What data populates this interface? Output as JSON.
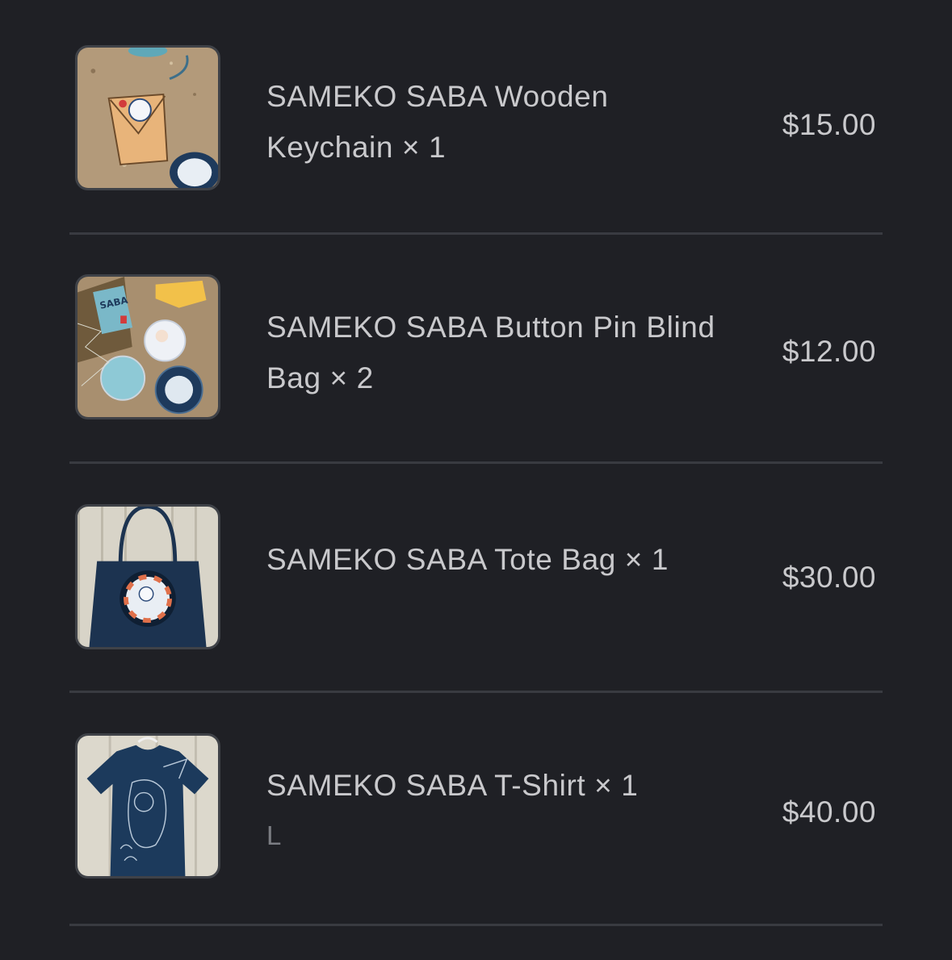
{
  "items": [
    {
      "name": "SAMEKO SABA Wooden Keychain × 1",
      "variant": "",
      "price": "$15.00",
      "image": "wooden-keychain-photo"
    },
    {
      "name": "SAMEKO SABA Button Pin Blind Bag × 2",
      "variant": "",
      "price": "$12.00",
      "image": "button-pin-photo"
    },
    {
      "name": "SAMEKO SABA Tote Bag × 1",
      "variant": "",
      "price": "$30.00",
      "image": "tote-bag-photo"
    },
    {
      "name": "SAMEKO SABA T-Shirt × 1",
      "variant": "L",
      "price": "$40.00",
      "image": "t-shirt-photo"
    }
  ],
  "colors": {
    "background": "#1f2025",
    "divider": "#393b41",
    "text": "#c9c9cc",
    "muted": "#7b7d83"
  }
}
